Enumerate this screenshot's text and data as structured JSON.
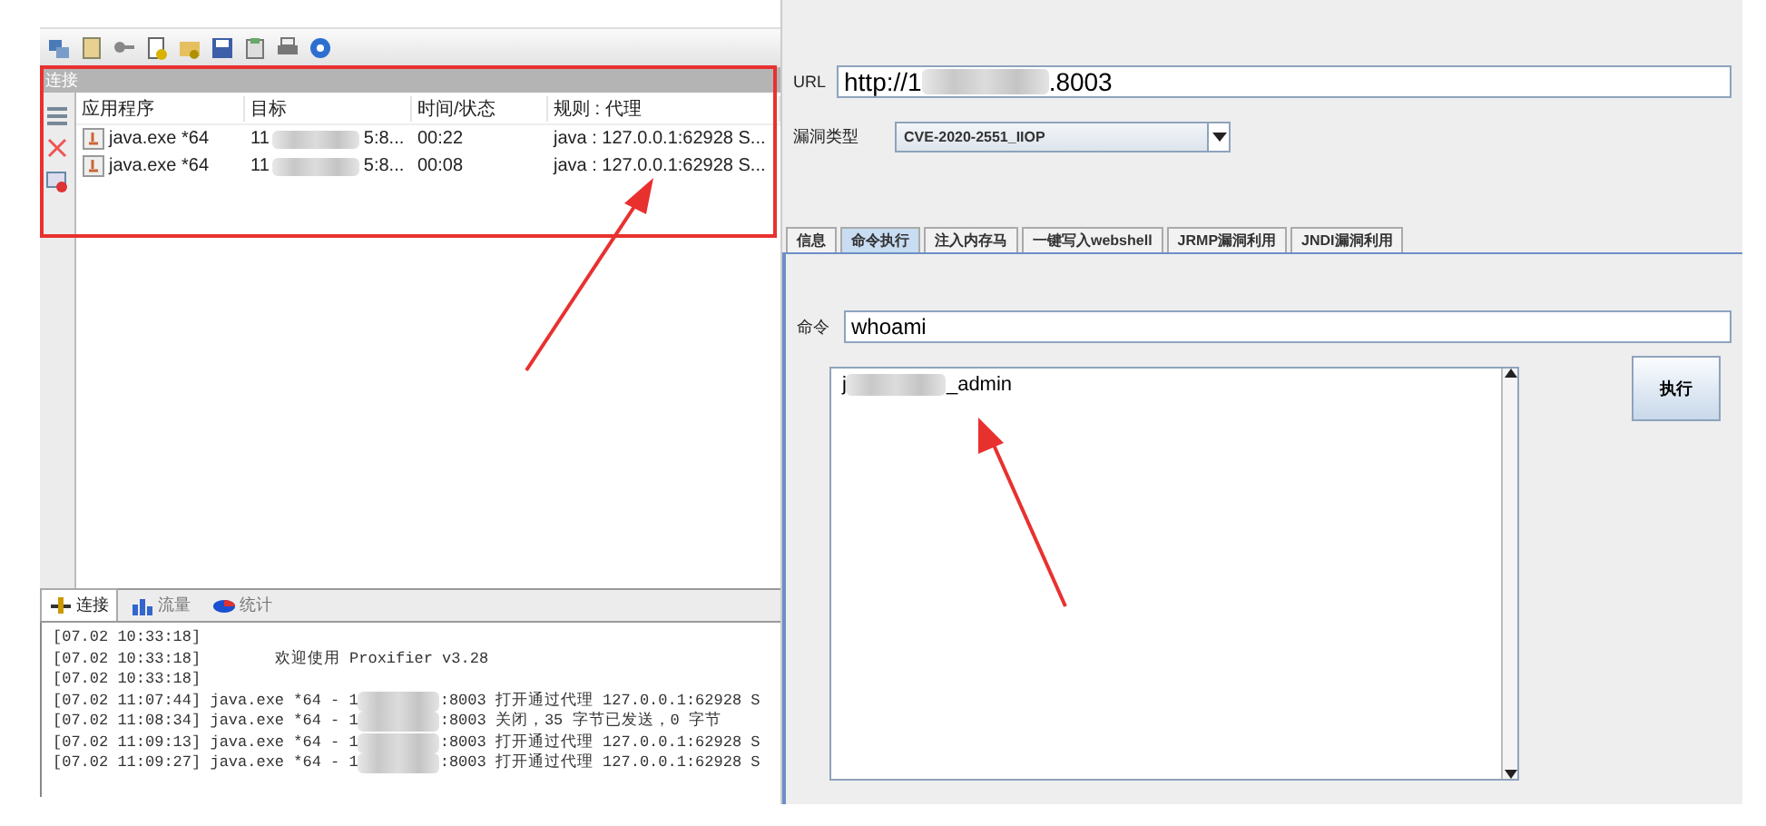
{
  "connections": {
    "title": "连接",
    "columns": [
      "应用程序",
      "目标",
      "时间/状态",
      "规则 : 代理"
    ],
    "rows": [
      {
        "app": "java.exe *64",
        "target_start": "11",
        "target_end": "5:8...",
        "time": "00:22",
        "rule": "java : 127.0.0.1:62928 S..."
      },
      {
        "app": "java.exe *64",
        "target_start": "11",
        "target_end": "5:8...",
        "time": "00:08",
        "rule": "java : 127.0.0.1:62928 S..."
      }
    ]
  },
  "bottom_tabs": [
    {
      "label": "连接",
      "selected": true
    },
    {
      "label": "流量",
      "selected": false
    },
    {
      "label": "统计",
      "selected": false
    }
  ],
  "log": [
    {
      "timestamp": "[07.02 10:33:18]"
    },
    {
      "timestamp": "[07.02 10:33:18]",
      "text": "欢迎使用 Proxifier v3.28"
    },
    {
      "timestamp": "[07.02 10:33:18]"
    },
    {
      "timestamp": "[07.02 11:07:44]",
      "text": "java.exe *64 - 1",
      "text_end": ":8003 打开通过代理 127.0.0.1:62928 S"
    },
    {
      "timestamp": "[07.02 11:08:34]",
      "text": "java.exe *64 - 1",
      "text_end": ":8003 关闭，35 字节已发送，0 字节"
    },
    {
      "timestamp": "[07.02 11:09:13]",
      "text": "java.exe *64 - 1",
      "text_end": ":8003 打开通过代理 127.0.0.1:62928 S"
    },
    {
      "timestamp": "[07.02 11:09:27]",
      "text": "java.exe *64 - 1",
      "text_end": ":8003 打开通过代理 127.0.0.1:62928 S"
    }
  ],
  "url": {
    "label": "URL",
    "value_start": "http://1",
    "value_end": ".8003"
  },
  "vuln_type": {
    "label": "漏洞类型",
    "value": "CVE-2020-2551_IIOP"
  },
  "tabs": [
    {
      "label": "信息",
      "selected": false
    },
    {
      "label": "命令执行",
      "selected": true
    },
    {
      "label": "注入内存马",
      "selected": false
    },
    {
      "label": "一键写入webshell",
      "selected": false
    },
    {
      "label": "JRMP漏洞利用",
      "selected": false
    },
    {
      "label": "JNDI漏洞利用",
      "selected": false
    }
  ],
  "command": {
    "label": "命令",
    "value": "whoami"
  },
  "output": {
    "start": "j",
    "end": "_admin"
  },
  "execute_button": "执行"
}
